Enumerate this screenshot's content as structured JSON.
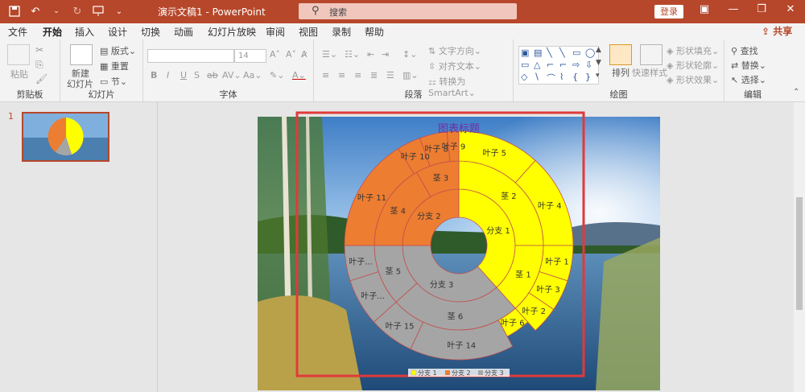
{
  "app": {
    "doc_title": "演示文稿1 - PowerPoint",
    "search_placeholder": "搜索",
    "login": "登录",
    "share": "共享"
  },
  "tabs": [
    "文件",
    "开始",
    "插入",
    "设计",
    "切换",
    "动画",
    "幻灯片放映",
    "审阅",
    "视图",
    "录制",
    "帮助"
  ],
  "ribbon": {
    "clipboard": {
      "paste": "粘贴",
      "label": "剪贴板"
    },
    "slides": {
      "new_slide_1": "新建",
      "new_slide_2": "幻灯片",
      "layout": "版式",
      "reset": "重置",
      "section": "节",
      "label": "幻灯片"
    },
    "font": {
      "size": "14",
      "label": "字体"
    },
    "paragraph": {
      "text_direction": "文字方向",
      "align_text": "对齐文本",
      "smartart": "转换为 SmartArt",
      "label": "段落"
    },
    "drawing": {
      "arrange": "排列",
      "quick_styles": "快速样式",
      "fill": "形状填充",
      "outline": "形状轮廓",
      "effects": "形状效果",
      "label": "绘图"
    },
    "editing": {
      "find": "查找",
      "replace": "替换",
      "select": "选择",
      "label": "编辑"
    }
  },
  "slide_panel": {
    "number": "1"
  },
  "colors": {
    "accent": "#b7472a",
    "yellow": "#ffff00",
    "orange": "#ed7d31",
    "gray": "#a5a5a5",
    "title": "#7030a0",
    "selection": "#e03a3a"
  },
  "chart_data": {
    "type": "sunburst",
    "title": "图表标题",
    "rings": [
      {
        "level": 1,
        "segments": [
          {
            "label": "分支 1",
            "series": "分支 1"
          },
          {
            "label": "分支 3",
            "series": "分支 3"
          },
          {
            "label": "分支 2",
            "series": "分支 2"
          }
        ]
      },
      {
        "level": 2,
        "segments": [
          {
            "label": "茎 2",
            "parent": "分支 1"
          },
          {
            "label": "茎 1",
            "parent": "分支 1"
          },
          {
            "label": "茎 6",
            "parent": "分支 3"
          },
          {
            "label": "茎 5",
            "parent": "分支 3"
          },
          {
            "label": "茎 4",
            "parent": "分支 2"
          },
          {
            "label": "茎 3",
            "parent": "分支 2"
          }
        ]
      },
      {
        "level": 3,
        "segments": [
          {
            "label": "叶子 5"
          },
          {
            "label": "叶子 4"
          },
          {
            "label": "叶子 1"
          },
          {
            "label": "叶子 3"
          },
          {
            "label": "叶子 2"
          },
          {
            "label": "叶子 6"
          },
          {
            "label": "叶子 14"
          },
          {
            "label": "叶子 15"
          },
          {
            "label": "叶子..."
          },
          {
            "label": "叶子..."
          },
          {
            "label": "叶子 11"
          },
          {
            "label": "叶子 10"
          },
          {
            "label": "叶子 8"
          },
          {
            "label": "叶子 9"
          }
        ]
      }
    ],
    "legend": [
      "分支 1",
      "分支 2",
      "分支 3"
    ],
    "legend_position": "bottom"
  }
}
